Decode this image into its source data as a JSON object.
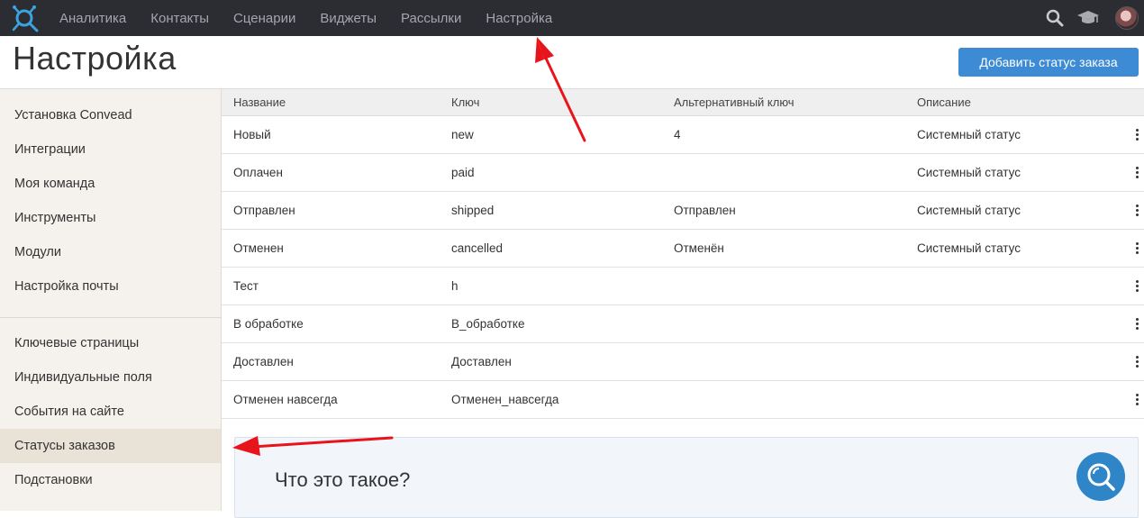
{
  "nav": {
    "items": [
      "Аналитика",
      "Контакты",
      "Сценарии",
      "Виджеты",
      "Рассылки",
      "Настройка"
    ]
  },
  "header": {
    "title": "Настройка",
    "add_button": "Добавить статус заказа"
  },
  "sidebar": {
    "group1": [
      "Установка Convead",
      "Интеграции",
      "Моя команда",
      "Инструменты",
      "Модули",
      "Настройка почты"
    ],
    "group2": [
      "Ключевые страницы",
      "Индивидуальные поля",
      "События на сайте",
      "Статусы заказов",
      "Подстановки"
    ],
    "active": "Статусы заказов"
  },
  "table": {
    "columns": [
      "Название",
      "Ключ",
      "Альтернативный ключ",
      "Описание"
    ],
    "rows": [
      [
        "Новый",
        "new",
        "4",
        "Системный статус"
      ],
      [
        "Оплачен",
        "paid",
        "",
        "Системный статус"
      ],
      [
        "Отправлен",
        "shipped",
        "Отправлен",
        "Системный статус"
      ],
      [
        "Отменен",
        "cancelled",
        "Отменён",
        "Системный статус"
      ],
      [
        "Тест",
        "h",
        "",
        ""
      ],
      [
        "В обработке",
        "В_обработке",
        "",
        ""
      ],
      [
        "Доставлен",
        "Доставлен",
        "",
        ""
      ],
      [
        "Отменен навсегда",
        "Отменен_навсегда",
        "",
        ""
      ]
    ]
  },
  "info": {
    "title": "Что это такое?"
  },
  "colors": {
    "topbar": "#2b2d33",
    "accent": "#3d8bd4",
    "annotation_arrow": "#e8141b"
  },
  "icons": [
    "logo-icon",
    "search-icon",
    "graduation-cap-icon",
    "avatar",
    "more-vertical-icon",
    "help-search-icon"
  ]
}
